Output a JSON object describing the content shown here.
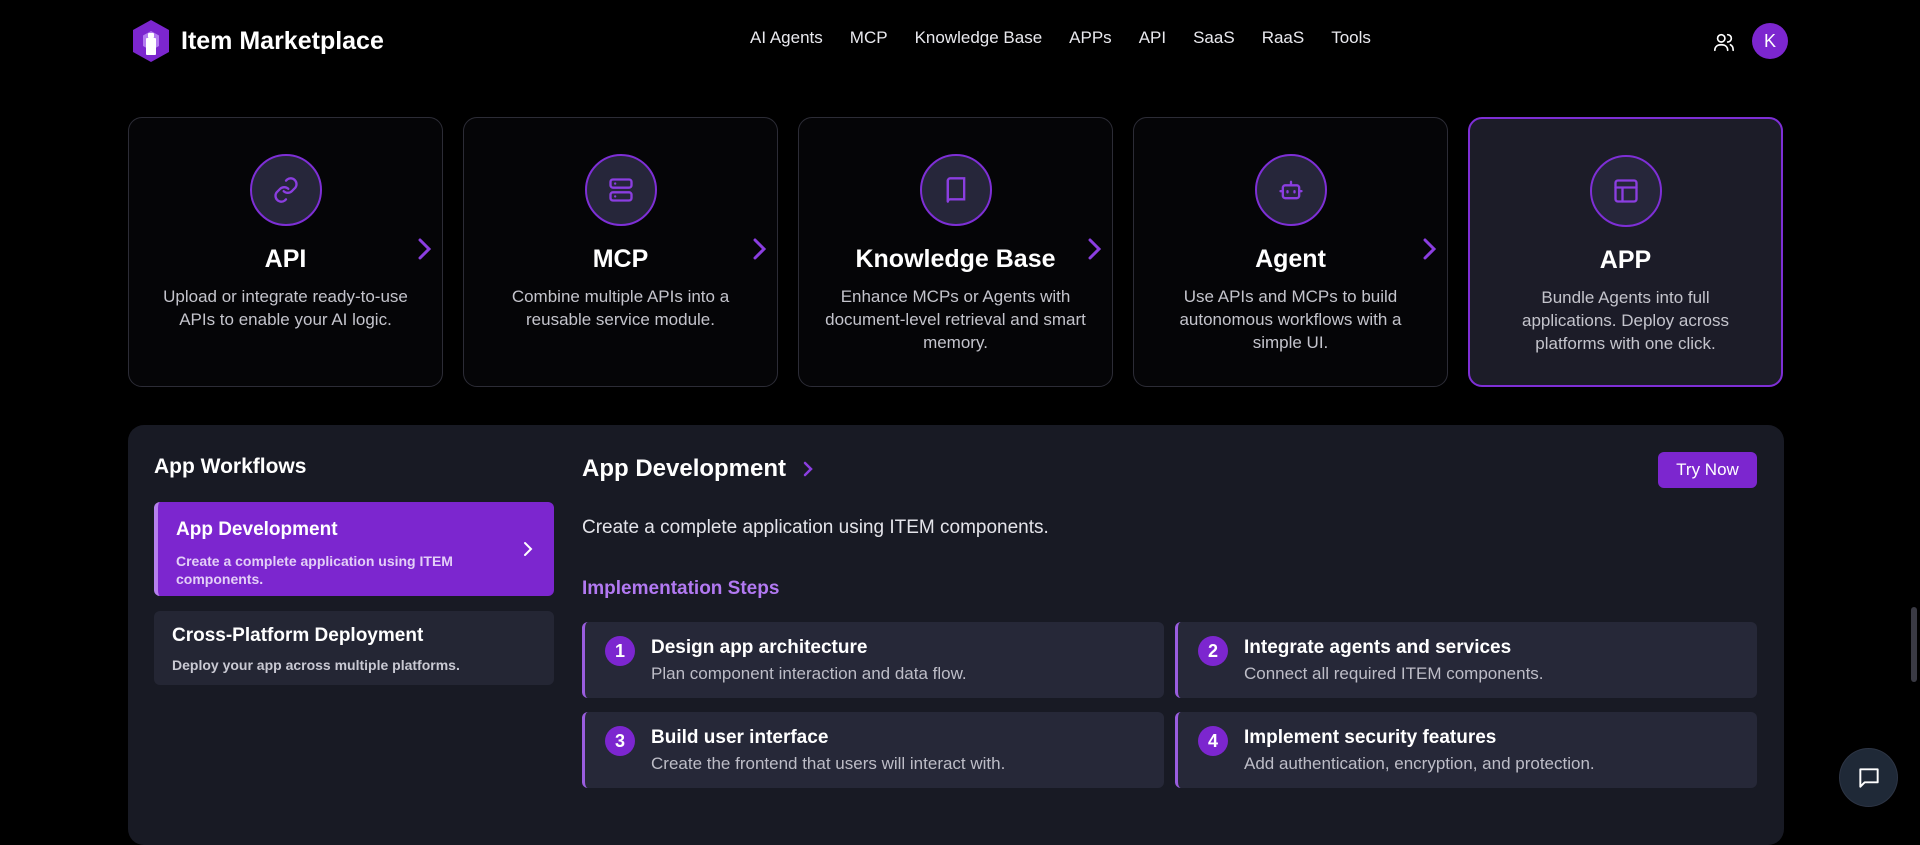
{
  "header": {
    "title": "Item Marketplace",
    "nav": [
      "AI Agents",
      "MCP",
      "Knowledge Base",
      "APPs",
      "API",
      "SaaS",
      "RaaS",
      "Tools"
    ],
    "avatar_letter": "K"
  },
  "cards": [
    {
      "title": "API",
      "desc": "Upload or integrate ready-to-use APIs to enable your AI logic.",
      "icon": "link-icon"
    },
    {
      "title": "MCP",
      "desc": "Combine multiple APIs into a reusable service module.",
      "icon": "server-icon"
    },
    {
      "title": "Knowledge Base",
      "desc": "Enhance MCPs or Agents with document-level retrieval and smart memory.",
      "icon": "book-icon"
    },
    {
      "title": "Agent",
      "desc": "Use APIs and MCPs to build autonomous workflows with a simple UI.",
      "icon": "bot-icon"
    },
    {
      "title": "APP",
      "desc": "Bundle Agents into full applications. Deploy across platforms with one click.",
      "icon": "layout-icon"
    }
  ],
  "workflows": {
    "title": "App Workflows",
    "items": [
      {
        "title": "App Development",
        "desc": "Create a complete application using ITEM components."
      },
      {
        "title": "Cross-Platform Deployment",
        "desc": "Deploy your app across multiple platforms."
      }
    ]
  },
  "detail": {
    "title": "App Development",
    "try_label": "Try Now",
    "desc": "Create a complete application using ITEM components.",
    "steps_title": "Implementation Steps",
    "steps": [
      {
        "num": "1",
        "title": "Design app architecture",
        "desc": "Plan component interaction and data flow."
      },
      {
        "num": "2",
        "title": "Integrate agents and services",
        "desc": "Connect all required ITEM components."
      },
      {
        "num": "3",
        "title": "Build user interface",
        "desc": "Create the frontend that users will interact with."
      },
      {
        "num": "4",
        "title": "Implement security features",
        "desc": "Add authentication, encryption, and protection."
      }
    ]
  },
  "colors": {
    "accent": "#7c26cf",
    "panel": "#181a24",
    "background": "#000000"
  }
}
